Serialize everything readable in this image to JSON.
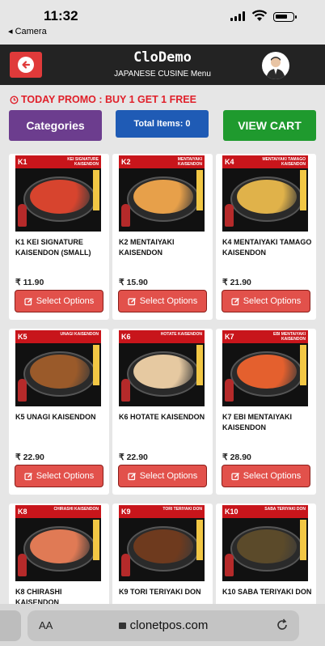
{
  "status_bar": {
    "time": "11:32",
    "back_app": "◂ Camera"
  },
  "header": {
    "title": "CloDemo",
    "subtitle": "JAPANESE CUSINE Menu"
  },
  "promo": {
    "text": "TODAY PROMO : BUY 1 GET 1 FREE"
  },
  "actions": {
    "categories": "Categories",
    "total_items": "Total Items: 0",
    "view_cart": "VIEW CART"
  },
  "option_label": "Select Options",
  "products": [
    {
      "code": "K1",
      "tag": "KEI SIGNATURE KAISENDON",
      "name": "K1 KEI SIGNATURE KAISENDON (SMALL)",
      "price": "₹ 11.90",
      "color": "#d7442e"
    },
    {
      "code": "K2",
      "tag": "MENTAIYAKI KAISENDON",
      "name": "K2 MENTAIYAKI KAISENDON",
      "price": "₹ 15.90",
      "color": "#e7a04a"
    },
    {
      "code": "K4",
      "tag": "MENTAIYAKI TAMAGO KAISENDON",
      "name": "K4 MENTAIYAKI TAMAGO KAISENDON",
      "price": "₹ 21.90",
      "color": "#e0b24a"
    },
    {
      "code": "K5",
      "tag": "UNAGI KAISENDON",
      "name": "K5 UNAGI KAISENDON",
      "price": "₹ 22.90",
      "color": "#9a5a2a"
    },
    {
      "code": "K6",
      "tag": "HOTATE KAISENDON",
      "name": "K6 HOTATE KAISENDON",
      "price": "₹ 22.90",
      "color": "#e6c9a1"
    },
    {
      "code": "K7",
      "tag": "EBI MENTAIYAKI KAISENDON",
      "name": "K7 EBI MENTAIYAKI KAISENDON",
      "price": "₹ 28.90",
      "color": "#e4602e"
    },
    {
      "code": "K8",
      "tag": "CHIRASHI KAISENDON",
      "name": "K8 CHIRASHI KAISENDON",
      "price": "",
      "color": "#e07a55"
    },
    {
      "code": "K9",
      "tag": "TORI TERIYAKI DON",
      "name": "K9 TORI TERIYAKI DON",
      "price": "",
      "color": "#6e3a1e"
    },
    {
      "code": "K10",
      "tag": "SABA TERIYAKI DON",
      "name": "K10 SABA TERIYAKI DON",
      "price": "",
      "color": "#5b4a2a"
    }
  ],
  "browser": {
    "aa": "AA",
    "url": "clonetpos.com"
  }
}
